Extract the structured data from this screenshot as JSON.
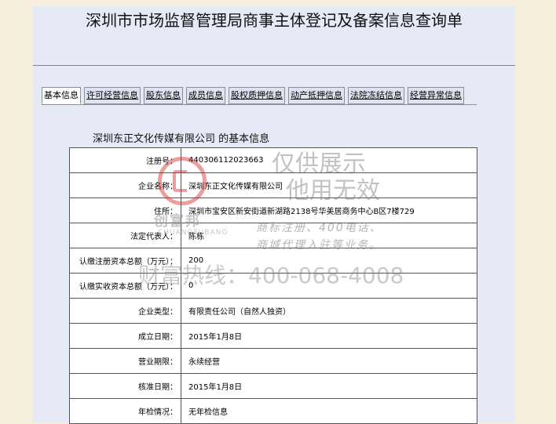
{
  "page": {
    "title": "深圳市市场监督管理局商事主体登记及备案信息查询单"
  },
  "tabs": [
    {
      "label": "基本信息"
    },
    {
      "label": "许可经营信息"
    },
    {
      "label": "股东信息"
    },
    {
      "label": "成员信息"
    },
    {
      "label": "股权质押信息"
    },
    {
      "label": "动产抵押信息"
    },
    {
      "label": "法院冻结信息"
    },
    {
      "label": "经营异常信息"
    }
  ],
  "company_heading": "深圳东正文化传媒有限公司 的基本信息",
  "rows": [
    {
      "label": "注册号：",
      "value": "440306112023663"
    },
    {
      "label": "企业名称：",
      "value": "深圳东正文化传媒有限公司"
    },
    {
      "label": "住所：",
      "value": "深圳市宝安区新安街道新湖路2138号华美居商务中心B区7楼729"
    },
    {
      "label": "法定代表人：",
      "value": "陈栋"
    },
    {
      "label": "认缴注册资本总额（万元）：",
      "value": "200"
    },
    {
      "label": "认缴实收资本总额（万元）：",
      "value": "0"
    },
    {
      "label": "企业类型：",
      "value": "有限责任公司（自然人独资）"
    },
    {
      "label": "成立日期：",
      "value": "2015年1月8日"
    },
    {
      "label": "营业期限：",
      "value": "永续经营"
    },
    {
      "label": "核准日期：",
      "value": "2015年1月8日"
    },
    {
      "label": "年检情况：",
      "value": "无年检信息"
    }
  ],
  "watermark": {
    "brand": "创富邦",
    "brand_sub": "CHUANGFUBANG",
    "line1": "仅供展示",
    "line2": "他用无效",
    "line3": "商标注册、400电话、",
    "line4": "商城代理入驻等业务。",
    "hotline": "财富热线：400-068-4008"
  }
}
